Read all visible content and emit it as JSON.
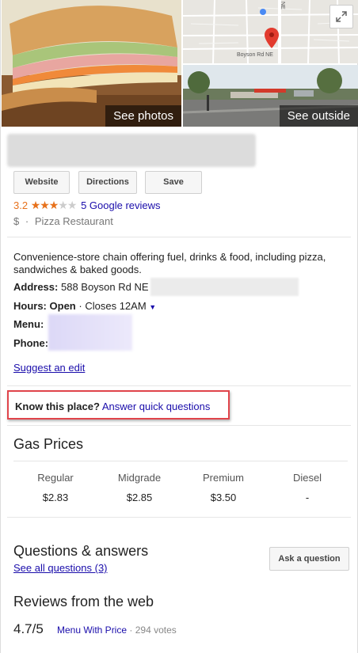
{
  "photos": {
    "see_photos": "See photos",
    "see_outside": "See outside",
    "map_road_label": "Boyson Rd NE",
    "map_vertical_label": "NE",
    "expand_icon": "expand-icon"
  },
  "actions": {
    "website": "Website",
    "directions": "Directions",
    "save": "Save"
  },
  "rating": {
    "value": "3.2",
    "stars_filled": 3,
    "stars_total": 5,
    "reviews_link": "5 Google reviews"
  },
  "meta": {
    "price": "$",
    "separator": "·",
    "category": "Pizza Restaurant"
  },
  "info": {
    "description": "Convenience-store chain offering fuel, drinks & food, including pizza, sandwiches & baked goods.",
    "address_label": "Address:",
    "address_value": "588 Boyson Rd NE",
    "hours_label": "Hours:",
    "hours_status": "Open",
    "hours_sep": "·",
    "hours_detail": "Closes 12AM",
    "menu_label": "Menu:",
    "phone_label": "Phone:",
    "suggest_edit": "Suggest an edit"
  },
  "know_place": {
    "label": "Know this place?",
    "link": "Answer quick questions"
  },
  "gas": {
    "title": "Gas Prices",
    "grades": [
      {
        "label": "Regular",
        "price": "$2.83"
      },
      {
        "label": "Midgrade",
        "price": "$2.85"
      },
      {
        "label": "Premium",
        "price": "$3.50"
      },
      {
        "label": "Diesel",
        "price": "-"
      }
    ]
  },
  "qa": {
    "title": "Questions & answers",
    "see_all": "See all questions (3)",
    "ask_button": "Ask a question"
  },
  "web_reviews": {
    "title": "Reviews from the web",
    "score": "4.7/5",
    "source": "Menu With Price",
    "sep": "·",
    "votes": "294 votes"
  },
  "colors": {
    "link": "#1a0dab",
    "star": "#e7711b",
    "highlight_border": "#e0444b",
    "map_pin": "#e23b2e"
  }
}
